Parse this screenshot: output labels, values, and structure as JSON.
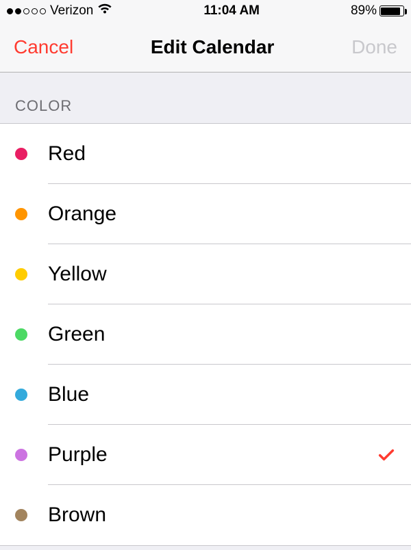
{
  "status_bar": {
    "carrier": "Verizon",
    "signal_filled": 2,
    "signal_total": 5,
    "time": "11:04 AM",
    "battery_pct": "89%",
    "battery_fill_pct": 89
  },
  "nav": {
    "cancel": "Cancel",
    "title": "Edit Calendar",
    "done": "Done"
  },
  "section_header": "COLOR",
  "colors": [
    {
      "label": "Red",
      "hex": "#e91e63",
      "selected": false
    },
    {
      "label": "Orange",
      "hex": "#ff9500",
      "selected": false
    },
    {
      "label": "Yellow",
      "hex": "#ffcc00",
      "selected": false
    },
    {
      "label": "Green",
      "hex": "#4cd964",
      "selected": false
    },
    {
      "label": "Blue",
      "hex": "#34aadc",
      "selected": false
    },
    {
      "label": "Purple",
      "hex": "#cc73e1",
      "selected": true
    },
    {
      "label": "Brown",
      "hex": "#a2845e",
      "selected": false
    }
  ],
  "checkmark_color": "#ff3b30"
}
